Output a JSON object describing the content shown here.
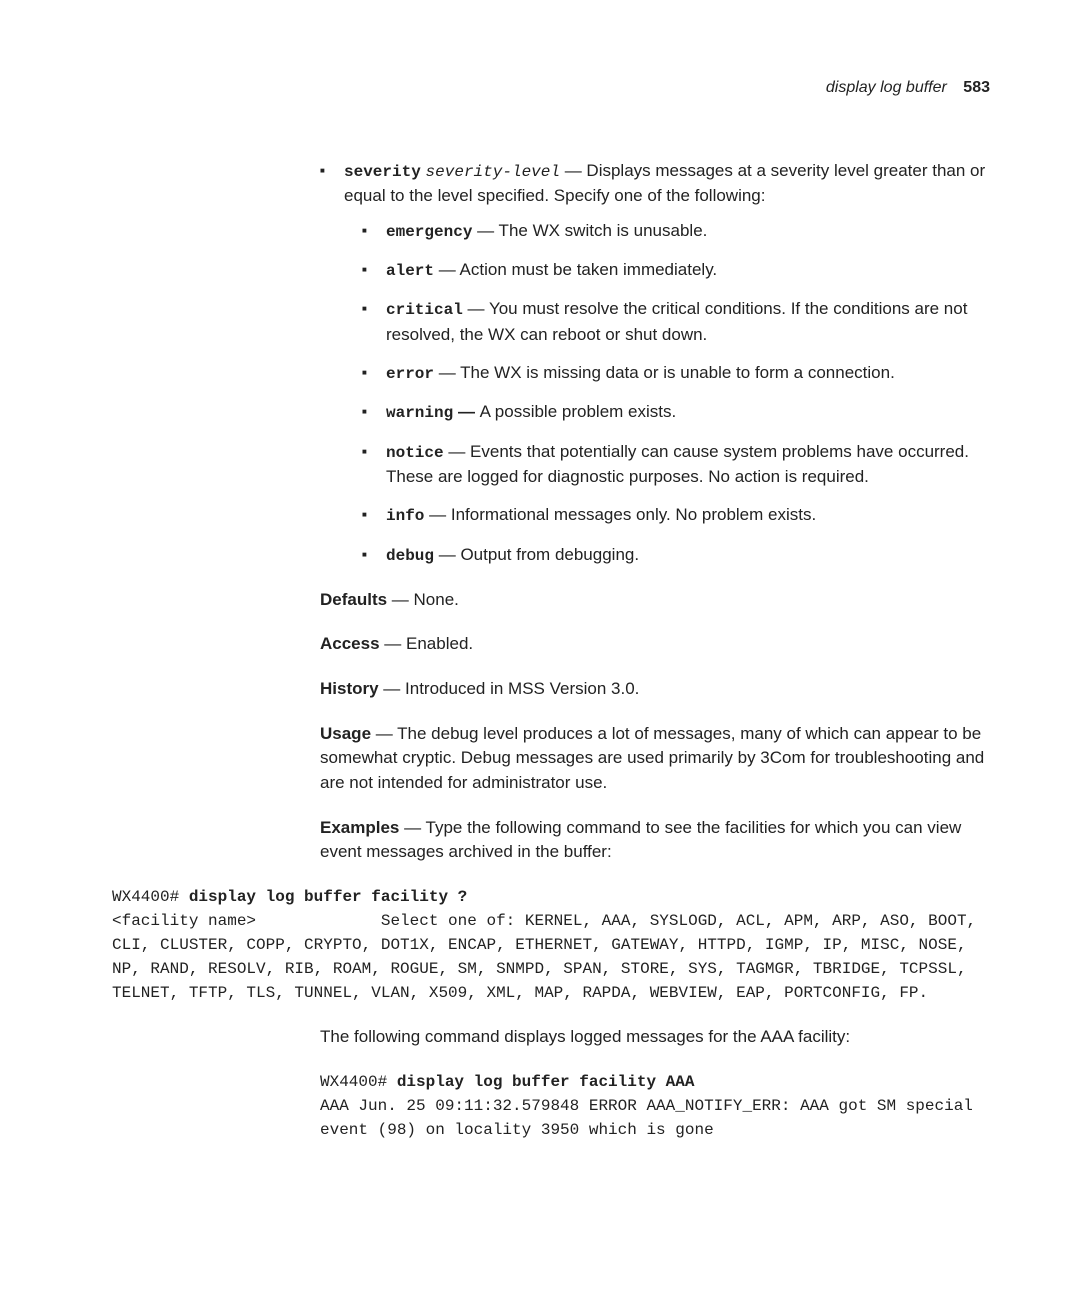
{
  "header": {
    "title": "display log buffer",
    "page": "583"
  },
  "severity_intro_code": "severity",
  "severity_intro_arg": "severity-level",
  "severity_intro_rest": " — Displays messages at a severity level greater than or equal to the level specified. Specify one of the following:",
  "levels": {
    "emergency": {
      "kw": "emergency",
      "txt": " — The WX switch is unusable."
    },
    "alert": {
      "kw": "alert",
      "txt": " — Action must be taken immediately."
    },
    "critical": {
      "kw": "critical",
      "txt": " — You must resolve the critical conditions. If the conditions are not resolved, the WX can reboot or shut down."
    },
    "error": {
      "kw": "error",
      "txt": " — The WX is missing data or is unable to form a connection."
    },
    "warning": {
      "kw": "warning",
      "txt": " A possible problem exists.",
      "sep": " — "
    },
    "notice": {
      "kw": "notice",
      "txt": " — Events that potentially can cause system problems have occurred. These are logged for diagnostic purposes. No action is required."
    },
    "info": {
      "kw": "info",
      "txt": " — Informational messages only. No problem exists."
    },
    "debug": {
      "kw": "debug",
      "txt": " — Output from debugging."
    }
  },
  "defaults": {
    "label": "Defaults",
    "value": " — None."
  },
  "access": {
    "label": "Access",
    "value": " — Enabled."
  },
  "history": {
    "label": "History",
    "value": " — Introduced in MSS Version 3.0."
  },
  "usage": {
    "label": "Usage",
    "value": " — The debug level produces a lot of messages, many of which can appear to be somewhat cryptic. Debug messages are used primarily by 3Com for troubleshooting and are not intended for administrator use."
  },
  "examples": {
    "label": "Examples",
    "value": " — Type the following command to see the facilities for which you can view event messages archived in the buffer:"
  },
  "cmd1_prompt": "WX4400# ",
  "cmd1_cmd": "display log buffer facility ?",
  "cmd1_output": "<facility name>             Select one of: KERNEL, AAA, SYSLOGD, ACL, APM, ARP, ASO, BOOT, CLI, CLUSTER, COPP, CRYPTO, DOT1X, ENCAP, ETHERNET, GATEWAY, HTTPD, IGMP, IP, MISC, NOSE, NP, RAND, RESOLV, RIB, ROAM, ROGUE, SM, SNMPD, SPAN, STORE, SYS, TAGMGR, TBRIDGE, TCPSSL, TELNET, TFTP, TLS, TUNNEL, VLAN, X509, XML, MAP, RAPDA, WEBVIEW, EAP, PORTCONFIG, FP.",
  "followup": "The following command displays logged messages for the AAA facility:",
  "cmd2_prompt": "WX4400# ",
  "cmd2_cmd": "display log buffer facility AAA",
  "cmd2_output": "AAA Jun. 25 09:11:32.579848 ERROR AAA_NOTIFY_ERR: AAA got SM special event (98) on locality 3950 which is gone"
}
